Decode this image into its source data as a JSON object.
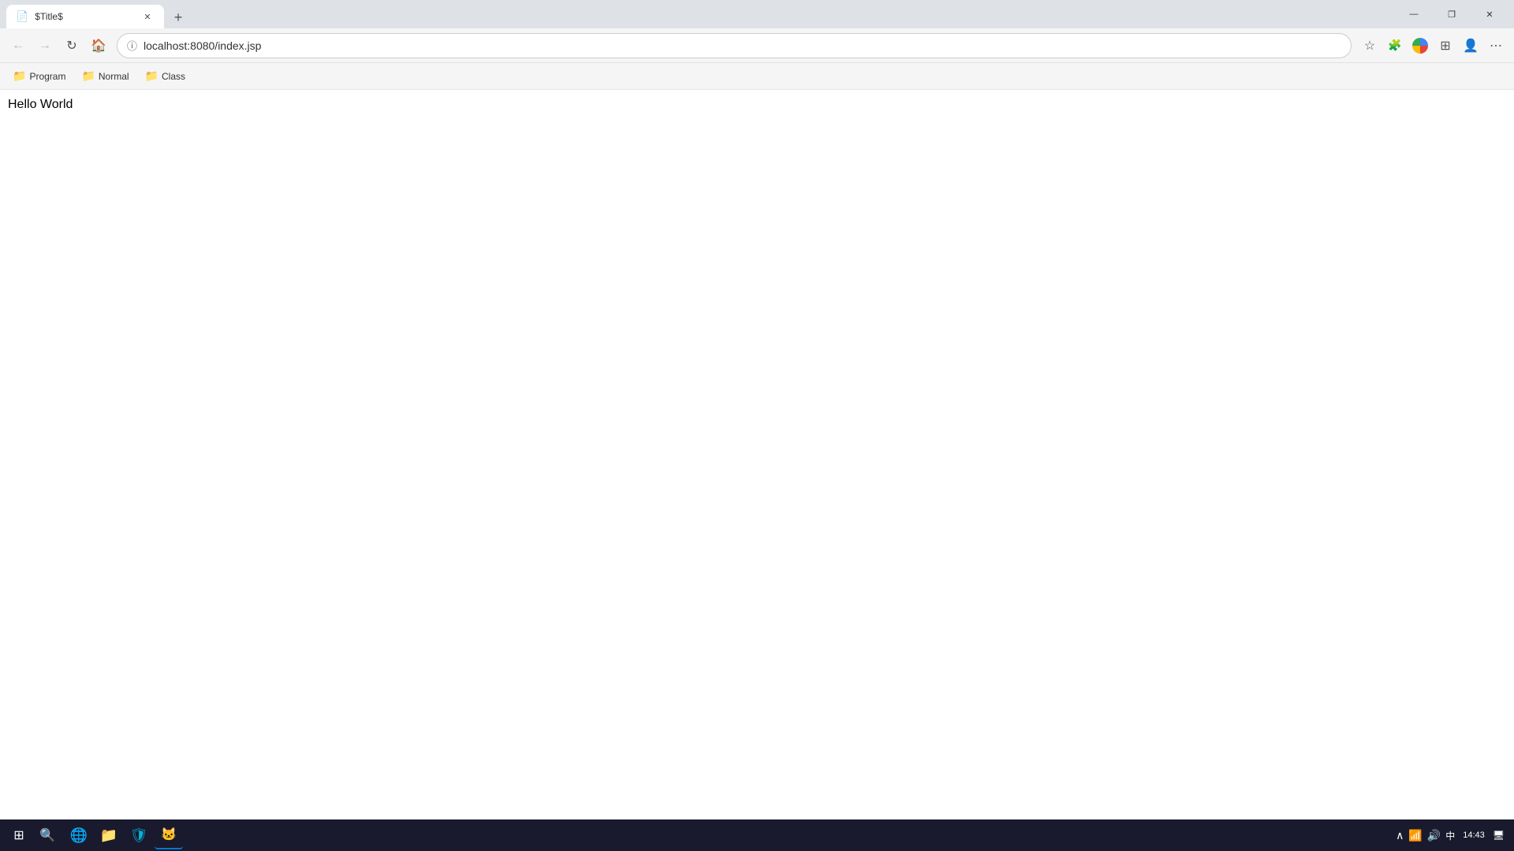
{
  "browser": {
    "tab": {
      "title": "$Title$",
      "icon": "📄"
    },
    "new_tab_icon": "+",
    "controls": {
      "minimize": "—",
      "maximize": "❐",
      "close": "✕"
    }
  },
  "navbar": {
    "back_disabled": true,
    "forward_disabled": true,
    "url": "localhost:8080/index.jsp",
    "star_tooltip": "Bookmark this page",
    "extensions_tooltip": "Extensions",
    "menu_tooltip": "Settings and more"
  },
  "bookmarks": [
    {
      "label": "Program",
      "icon": "📁"
    },
    {
      "label": "Normal",
      "icon": "📁"
    },
    {
      "label": "Class",
      "icon": "📁"
    }
  ],
  "page": {
    "content": "Hello World"
  },
  "taskbar": {
    "time": "14:43",
    "items": [
      {
        "icon": "🌐",
        "name": "edge",
        "label": "Microsoft Edge"
      },
      {
        "icon": "📁",
        "name": "explorer",
        "label": "File Explorer"
      },
      {
        "icon": "🛡",
        "name": "defender",
        "label": "Windows Security"
      },
      {
        "icon": "🐱",
        "name": "app4",
        "label": "App"
      }
    ]
  }
}
